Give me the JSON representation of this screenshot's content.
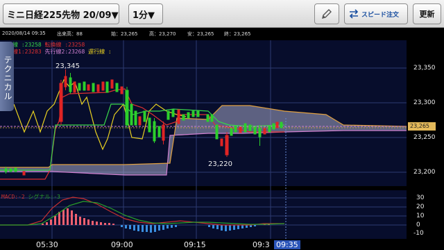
{
  "toolbar": {
    "symbol": "ミニ日経225先物 20/09▼",
    "interval": "1分▼",
    "speed_order": "スピード注文",
    "update": "更新"
  },
  "info": {
    "datetime": "2020/08/14 09:35",
    "volume_label": "出来高：88",
    "open": "始：23,265",
    "high": "高：23,270",
    "low": "安：23,265",
    "close": "終：23,265"
  },
  "legend": {
    "kijun": "基準線 :23258",
    "tenkan": "転換線 :23258",
    "senkou1": "先行線1:23283",
    "senkou2": "先行線2:23268",
    "chikou": "遅行線 :"
  },
  "macd_legend": {
    "macd": "MACD:-2",
    "signal": "シグナル:-3"
  },
  "tech_tab": "テクニカル",
  "annotations": {
    "high": "23,345",
    "low": "23,220"
  },
  "price_badge": "23,265",
  "y_axis": [
    "23,350",
    "23,300",
    "23,250",
    "23,200"
  ],
  "macd_axis": [
    "30",
    "20",
    "10",
    "0",
    "-10"
  ],
  "x_axis": [
    "05:30",
    "09:00",
    "09:15",
    "09:3",
    "09:35"
  ],
  "colors": {
    "background": "#000000",
    "grid": "#2c3a72",
    "candle_up": "#e02424",
    "candle_down": "#2ccf2c",
    "kijun": "#39d64a",
    "tenkan": "#e03030",
    "senkou1": "#e0a040",
    "senkou2": "#d080d0",
    "chikou": "#e8d020",
    "cloud": "#c8c8e8",
    "macd": "#c83030",
    "signal": "#2aa02a",
    "hist_pos": "#f06070",
    "hist_neg": "#3a8ee0"
  }
}
